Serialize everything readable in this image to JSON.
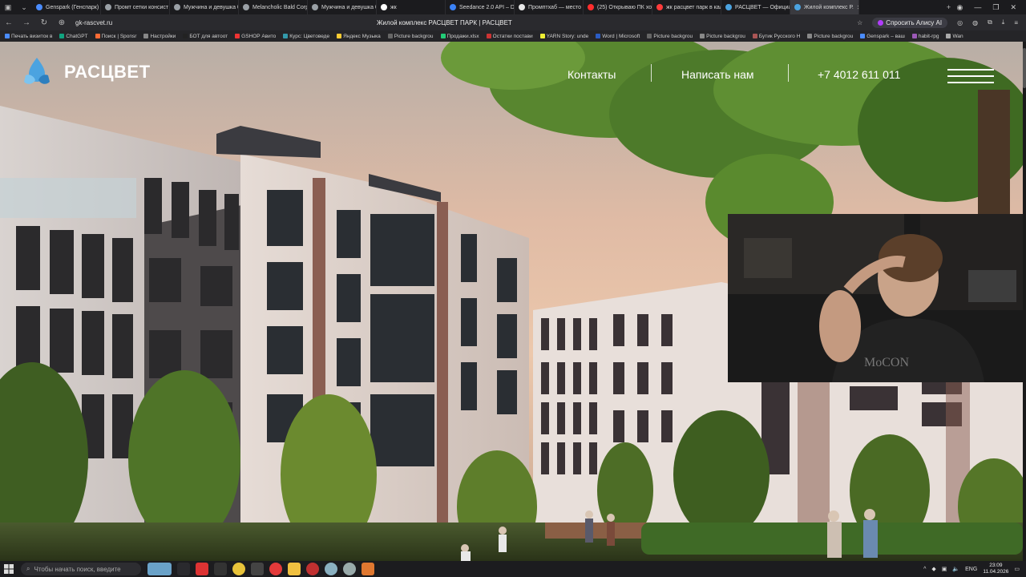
{
  "browser": {
    "tabs": [
      {
        "label": "Genspark (Генспарк)",
        "color": "#4a8cff"
      },
      {
        "label": "Промт сетки консист",
        "color": "#9aa0a6"
      },
      {
        "label": "Мужчина и девушка б",
        "color": "#9aa0a6"
      },
      {
        "label": "Melancholic Bald Corp",
        "color": "#9aa0a6"
      },
      {
        "label": "Мужчина и девушка б",
        "color": "#9aa0a6"
      },
      {
        "label": "жк",
        "color": "#ffffff"
      },
      {
        "label": "Seedance 2.0 API – Do",
        "color": "#3b82f6"
      },
      {
        "label": "Промптхаб — место с",
        "color": "#e6e6e6"
      },
      {
        "label": "(25) Открываю ПК хоу",
        "color": "#ff2d2d"
      },
      {
        "label": "жк расцвет парк в кал",
        "color": "#ff3b3b"
      },
      {
        "label": "РАСЦВЕТ — Официал",
        "color": "#4ba3e0"
      },
      {
        "label": "Жилой комплекс Р.",
        "color": "#4ba3e0",
        "active": true
      }
    ],
    "url": "gk-rascvet.ru",
    "page_title": "Жилой комплекс РАСЦВЕТ ПАРК | РАСЦВЕТ",
    "alice_label": "Спросить Алису AI",
    "bookmarks": [
      "Печать визиток в",
      "ChatGPT",
      "Поиск | Sponsr",
      "Настройки",
      "БОТ для автоот",
      "GSHOP Авито",
      "Курс: Цветоведе",
      "Яндекс Музыка",
      "Picture backgrou",
      "Продажи.xlsx",
      "Остатки постави",
      "YARN Story: unde",
      "Word | Microsoft",
      "Picture backgrou",
      "Picture backgrou",
      "Бутик Русского Н",
      "Picture backgrou",
      "Genspark – ваш",
      "habit-rpg",
      "Wan"
    ]
  },
  "site": {
    "logo_text": "РАСЦВЕТ",
    "nav": {
      "contacts": "Контакты",
      "write_us": "Написать нам",
      "phone": "+7 4012 611 011"
    }
  },
  "taskbar": {
    "search_placeholder": "Чтобы начать поиск, введите",
    "lang": "ENG",
    "time": "23:09",
    "date": "11.04.2026"
  },
  "colors": {
    "brand_blue": "#4ba3e0",
    "header_text": "#ffffff"
  }
}
